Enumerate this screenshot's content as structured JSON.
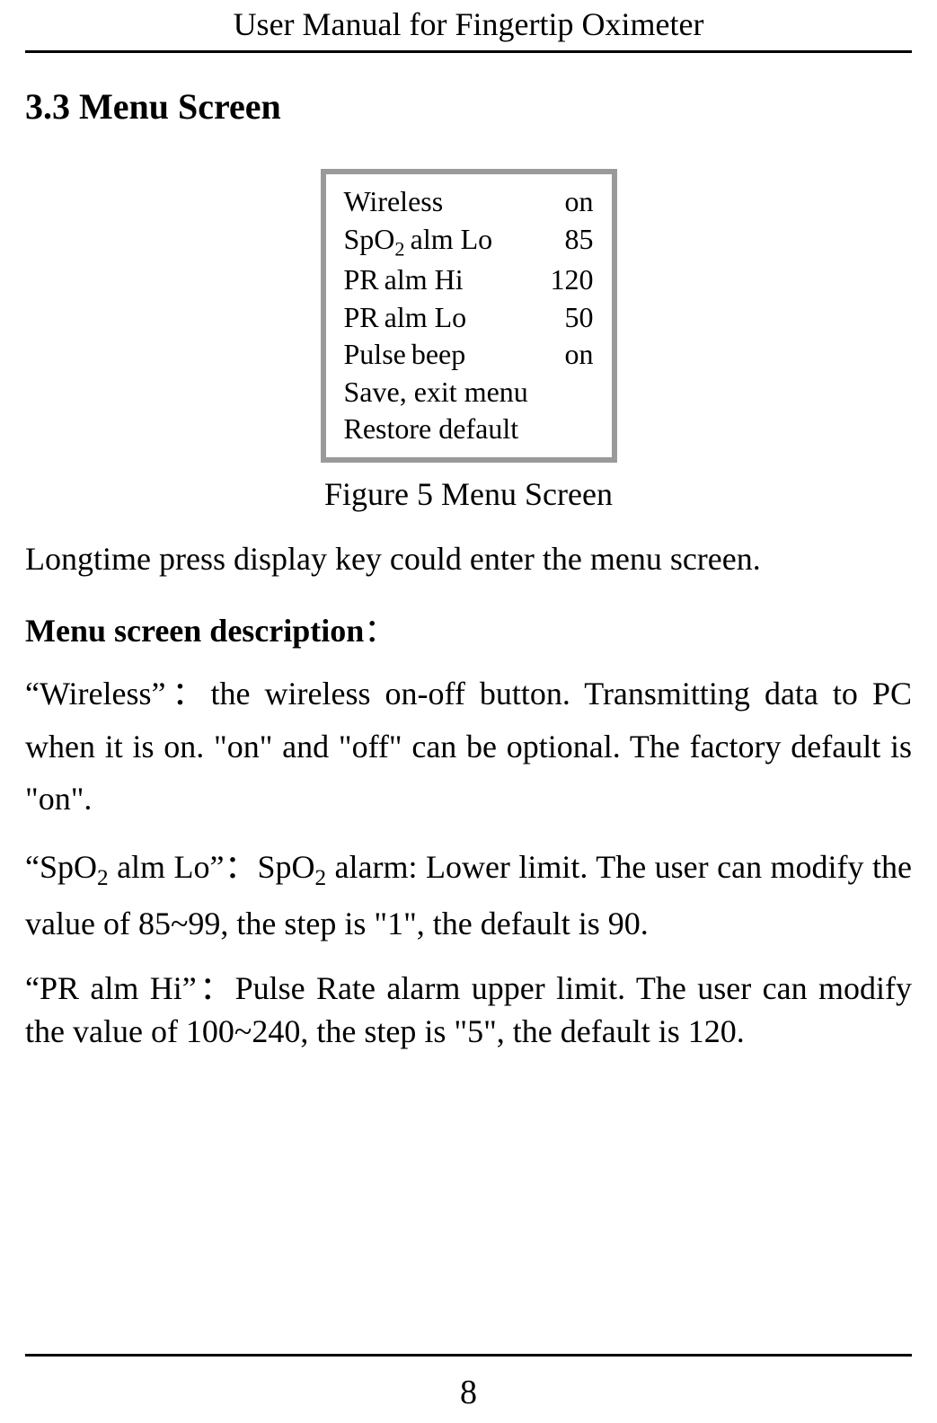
{
  "header": {
    "running_title": "User Manual for Fingertip Oximeter"
  },
  "section": {
    "heading": "3.3 Menu Screen"
  },
  "figure": {
    "caption": "Figure 5 Menu Screen",
    "menu": {
      "rows": [
        {
          "label": "Wireless",
          "mid": "",
          "value": "on"
        },
        {
          "label": "SpO",
          "sub": "2",
          "mid": " alm  Lo",
          "value": "85"
        },
        {
          "label": "PR",
          "mid": "alm  Hi",
          "value": "120"
        },
        {
          "label": "PR",
          "mid": "alm  Lo",
          "value": "50"
        },
        {
          "label": "Pulse",
          "mid": "beep",
          "value": "on"
        }
      ],
      "single_lines": [
        "Save, exit menu",
        "Restore default"
      ]
    }
  },
  "paragraphs": {
    "intro": "Longtime press display key could enter the menu screen.",
    "desc_heading": "Menu screen description",
    "desc_colon": "：",
    "wireless": "“Wireless”：the wireless on-off button. Transmitting data to PC when it is on. \"on\" and \"off\" can be optional. The factory default is \"on\".",
    "spo2_pre": "“SpO",
    "spo2_sub": "2",
    "spo2_mid": " alm Lo”：SpO",
    "spo2_sub2": "2",
    "spo2_post": " alarm: Lower limit. The user can modify the value of 85~99, the step is \"1\", the default is 90.",
    "prhi": "“PR alm Hi”：Pulse Rate alarm upper limit. The user can modify the value of 100~240, the step is \"5\", the default is 120."
  },
  "footer": {
    "page_number": "8"
  }
}
